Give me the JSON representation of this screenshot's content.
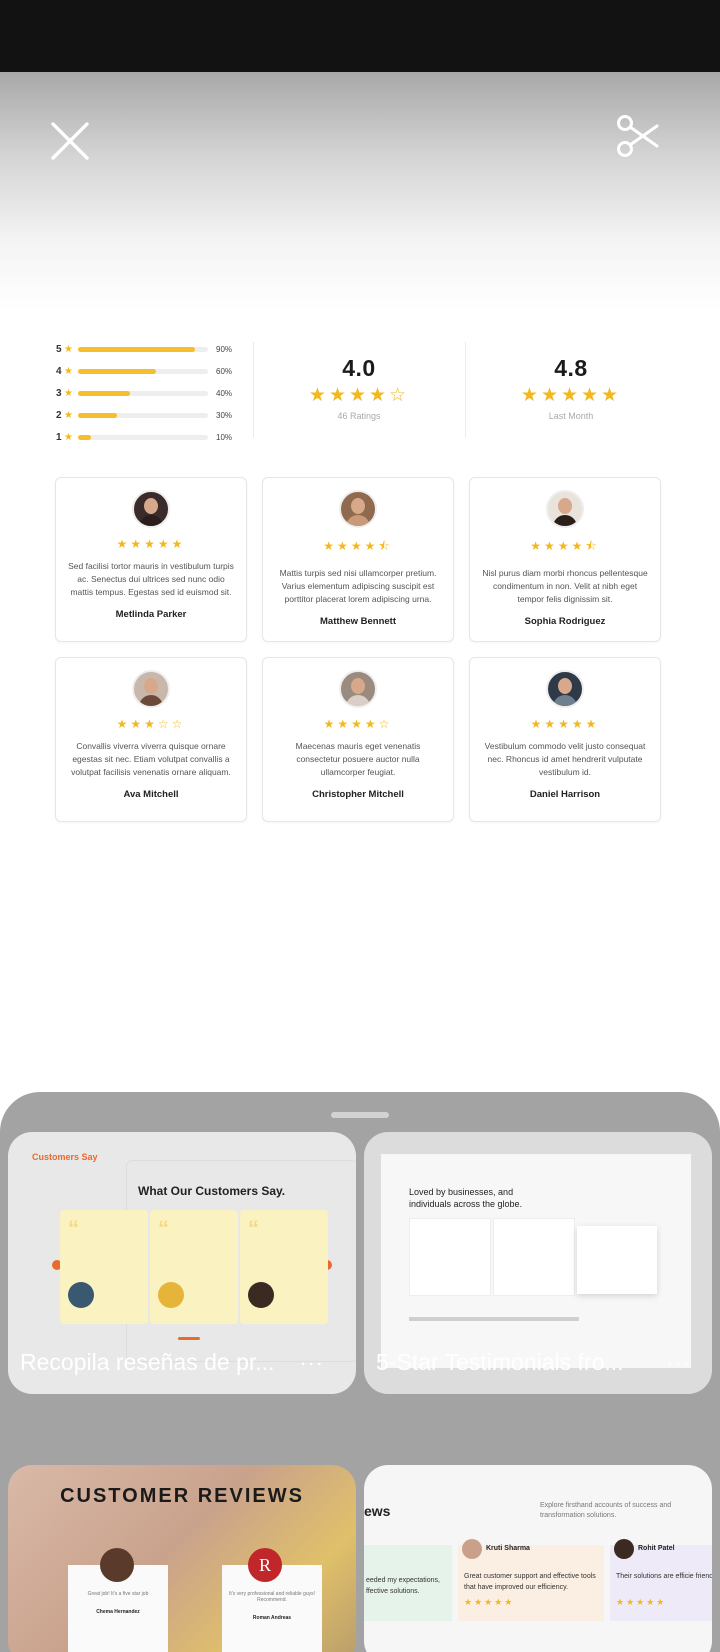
{
  "toolbar": {
    "close_icon": "close-icon",
    "scissors_icon": "scissors-icon"
  },
  "rating_distribution": [
    {
      "stars": "5",
      "fraction": 0.9,
      "percent": "90%"
    },
    {
      "stars": "4",
      "fraction": 0.6,
      "percent": "60%"
    },
    {
      "stars": "3",
      "fraction": 0.4,
      "percent": "40%"
    },
    {
      "stars": "2",
      "fraction": 0.3,
      "percent": "30%"
    },
    {
      "stars": "1",
      "fraction": 0.1,
      "percent": "10%"
    }
  ],
  "overall": {
    "value": "4.0",
    "stars": 4,
    "caption": "46 Ratings"
  },
  "last_month": {
    "value": "4.8",
    "stars": 5,
    "caption": "Last Month"
  },
  "reviews": [
    {
      "name": "Metlinda Parker",
      "text": "Sed facilisi tortor mauris in vestibulum turpis ac. Senectus dui ultrices sed nunc odio mattis tempus. Egestas sed id euismod sit.",
      "rating": 5
    },
    {
      "name": "Matthew Bennett",
      "text": "Mattis turpis sed nisi ullamcorper pretium. Varius elementum adipiscing suscipit est porttitor placerat lorem adipiscing urna.",
      "rating": 4.5
    },
    {
      "name": "Sophia Rodriguez",
      "text": "Nisl purus diam morbi rhoncus pellentesque condimentum in non. Velit at nibh eget tempor felis dignissim sit.",
      "rating": 4.5
    },
    {
      "name": "Ava Mitchell",
      "text": "Convallis viverra viverra quisque ornare egestas sit nec. Etiam volutpat convallis a volutpat facilisis venenatis ornare aliquam.",
      "rating": 3
    },
    {
      "name": "Christopher Mitchell",
      "text": "Maecenas mauris eget venenatis consectetur posuere auctor nulla ullamcorper feugiat.",
      "rating": 4
    },
    {
      "name": "Daniel Harrison",
      "text": "Vestibulum commodo velit justo consequat nec. Rhoncus id amet hendrerit vulputate vestibulum id.",
      "rating": 5
    }
  ],
  "sheet": {
    "results": [
      {
        "label": "Recopila reseñas de pr...",
        "more": "...",
        "heading": "What Our Customers Say.",
        "kicker": "Customers Say"
      },
      {
        "label": "5-Star Testimonials fro...",
        "more": "...",
        "heading": "Loved by businesses, and individuals across the globe."
      },
      {
        "heading": "CUSTOMER REVIEWS",
        "left_name": "Chema Hernandez",
        "right_name": "Roman Andreas",
        "left_quote": "Great job! It's a five star job",
        "right_quote": "It's very professional and reliable guys! Recommend."
      },
      {
        "heading": "ews",
        "intro": "Explore firsthand accounts of success and transformation solutions.",
        "left_quote": "eeded my expectations, ffective solutions.",
        "mid_name": "Kruti Sharma",
        "mid_quote": "Great customer support and effective tools that have improved our efficiency.",
        "right_name": "Rohit Patel",
        "right_quote": "Their solutions are efficie friendly, making our task"
      }
    ]
  },
  "colors": {
    "star": "#f4b81c",
    "bar": "#f4be2c",
    "sheet": "#a3a3a3",
    "accent_orange": "#e86a2c"
  }
}
